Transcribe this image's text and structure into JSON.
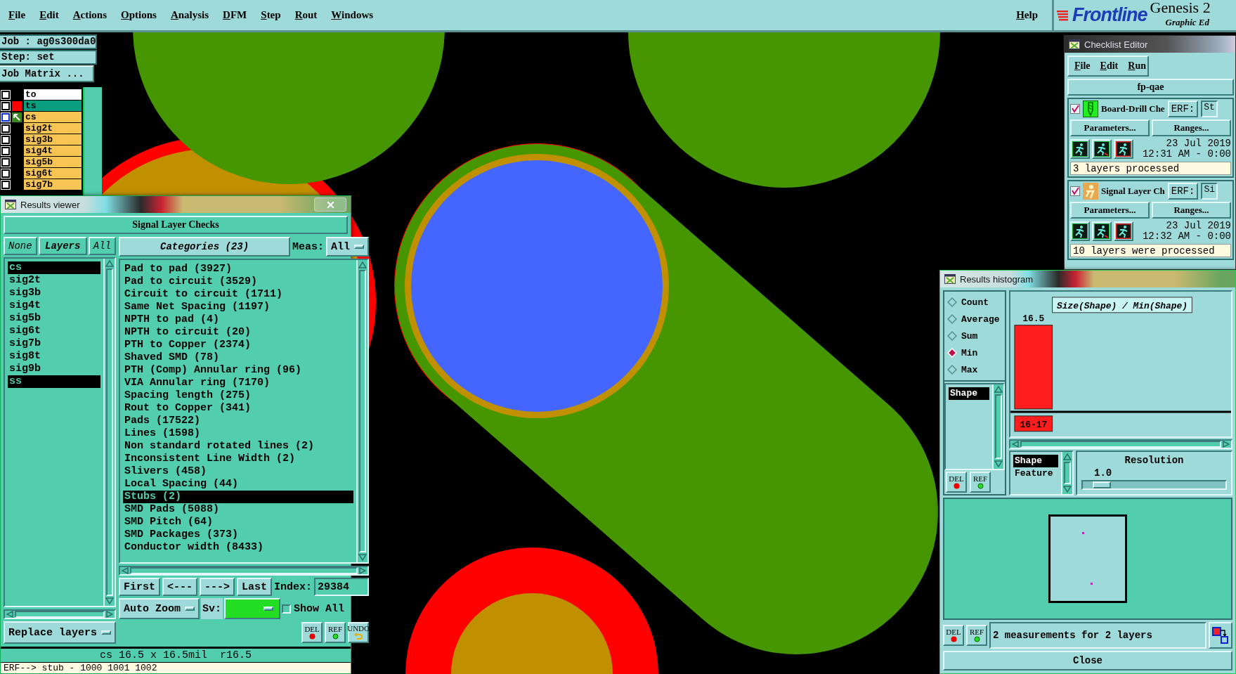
{
  "menu_bar": {
    "items": [
      "File",
      "Edit",
      "Actions",
      "Options",
      "Analysis",
      "DFM",
      "Step",
      "Rout",
      "Windows"
    ],
    "help": "Help"
  },
  "logo": {
    "brand": "Frontline",
    "product": "Genesis 2",
    "subtitle": "Graphic Ed"
  },
  "job_panel": {
    "job": "Job : ag0s300da0",
    "step": "Step: set",
    "matrix_button": "Job Matrix ...",
    "layers": [
      {
        "name": "to",
        "color": "#ffffff",
        "kind": "plain",
        "checked": false
      },
      {
        "name": "ts",
        "color": "#0a9e80",
        "kind": "swatch",
        "checked": false
      },
      {
        "name": "cs",
        "color": "#f8c555",
        "kind": "arrow",
        "checked": false
      },
      {
        "name": "sig2t",
        "color": "#f8c555",
        "kind": "plain",
        "checked": false
      },
      {
        "name": "sig3b",
        "color": "#f8c555",
        "kind": "plain",
        "checked": false
      },
      {
        "name": "sig4t",
        "color": "#f8c555",
        "kind": "plain",
        "checked": false
      },
      {
        "name": "sig5b",
        "color": "#f8c555",
        "kind": "plain",
        "checked": false
      },
      {
        "name": "sig6t",
        "color": "#f8c555",
        "kind": "plain",
        "checked": false
      },
      {
        "name": "sig7b",
        "color": "#f8c555",
        "kind": "plain",
        "checked": false
      }
    ]
  },
  "results_viewer": {
    "title": "Results viewer",
    "heading": "Signal Layer Checks",
    "layer_buttons": [
      "None",
      "Layers",
      "All"
    ],
    "layers": [
      {
        "name": "cs",
        "selected": true
      },
      {
        "name": "sig2t",
        "selected": false
      },
      {
        "name": "sig3b",
        "selected": false
      },
      {
        "name": "sig4t",
        "selected": false
      },
      {
        "name": "sig5b",
        "selected": false
      },
      {
        "name": "sig6t",
        "selected": false
      },
      {
        "name": "sig7b",
        "selected": false
      },
      {
        "name": "sig8t",
        "selected": false
      },
      {
        "name": "sig9b",
        "selected": false
      },
      {
        "name": "ss",
        "selected": true
      }
    ],
    "categories_button": "Categories (23)",
    "meas_label": "Meas:",
    "meas_value": "All",
    "categories": [
      {
        "name": "Pad to pad (3927)",
        "selected": false
      },
      {
        "name": "Pad to circuit (3529)",
        "selected": false
      },
      {
        "name": "Circuit to circuit (1711)",
        "selected": false
      },
      {
        "name": "Same Net Spacing (1197)",
        "selected": false
      },
      {
        "name": "NPTH to pad (4)",
        "selected": false
      },
      {
        "name": "NPTH to circuit (20)",
        "selected": false
      },
      {
        "name": "PTH to Copper (2374)",
        "selected": false
      },
      {
        "name": "Shaved SMD (78)",
        "selected": false
      },
      {
        "name": "PTH (Comp) Annular ring (96)",
        "selected": false
      },
      {
        "name": "VIA Annular ring (7170)",
        "selected": false
      },
      {
        "name": "Spacing length (275)",
        "selected": false
      },
      {
        "name": "Rout to Copper (341)",
        "selected": false
      },
      {
        "name": "Pads (17522)",
        "selected": false
      },
      {
        "name": "Lines (1598)",
        "selected": false
      },
      {
        "name": "Non standard rotated lines (2)",
        "selected": false
      },
      {
        "name": "Inconsistent Line Width (2)",
        "selected": false
      },
      {
        "name": "Slivers (458)",
        "selected": false
      },
      {
        "name": "Local Spacing (44)",
        "selected": false
      },
      {
        "name": "Stubs (2)",
        "selected": true
      },
      {
        "name": "SMD Pads (5088)",
        "selected": false
      },
      {
        "name": "SMD Pitch (64)",
        "selected": false
      },
      {
        "name": "SMD Packages (373)",
        "selected": false
      },
      {
        "name": "Conductor width (8433)",
        "selected": false
      }
    ],
    "nav_buttons": [
      "First",
      "<---",
      "--->",
      "Last"
    ],
    "index_label": "Index:",
    "index_value": "29384",
    "zoom_mode": "Auto Zoom",
    "sv_label": "Sv:",
    "show_all": {
      "label": "Show All",
      "checked": false
    },
    "tool_buttons": [
      {
        "label": "DEL",
        "kind": "delete"
      },
      {
        "label": "REF",
        "kind": "refresh"
      },
      {
        "label": "UNDO",
        "kind": "undo"
      }
    ],
    "replace_mode": "Replace layers",
    "status": "cs 16.5 x 16.5mil  r16.5",
    "erf_line": "ERF--> stub - 1000 1001 1002"
  },
  "checklist_editor": {
    "title": "Checklist Editor",
    "menu": [
      "File",
      "Edit",
      "Run"
    ],
    "name": "fp-qae",
    "actions": [
      {
        "name": "Board-Drill Che",
        "kind": "drill",
        "checked": true,
        "erf_label": "ERF:",
        "erf_value": "St",
        "params": "Parameters...",
        "ranges": "Ranges...",
        "date": "23 Jul 2019",
        "time": "12:31 AM - 0:00",
        "status": "3 layers processed"
      },
      {
        "name": "Signal Layer Ch",
        "kind": "signal",
        "checked": true,
        "erf_label": "ERF:",
        "erf_value": "Si",
        "params": "Parameters...",
        "ranges": "Ranges...",
        "date": "23 Jul 2019",
        "time": "12:32 AM - 0:00",
        "status": "10 layers were processed"
      }
    ]
  },
  "histogram": {
    "title": "Results histogram",
    "modes": [
      {
        "label": "Count",
        "selected": false
      },
      {
        "label": "Average",
        "selected": false
      },
      {
        "label": "Sum",
        "selected": false
      },
      {
        "label": "Min",
        "selected": true
      },
      {
        "label": "Max",
        "selected": false
      }
    ],
    "attributes": [
      {
        "label": "Shape",
        "selected": true
      }
    ],
    "side_buttons": [
      {
        "label": "DEL",
        "kind": "delete"
      },
      {
        "label": "REF",
        "kind": "refresh"
      }
    ],
    "chart": {
      "title": "Size(Shape) / Min(Shape)",
      "bar_label": "16.5",
      "bin_label": "16-17"
    },
    "fields": [
      {
        "label": "Shape",
        "selected": true
      },
      {
        "label": "Feature",
        "selected": false
      }
    ],
    "resolution_label": "Resolution",
    "resolution_value": "1.0",
    "resolution_slider": {
      "level": 0.08
    },
    "bottom_buttons": [
      {
        "label": "DEL",
        "kind": "delete"
      },
      {
        "label": "REF",
        "kind": "refresh"
      }
    ],
    "summary": "2 measurements for 2 layers",
    "close": "Close"
  }
}
